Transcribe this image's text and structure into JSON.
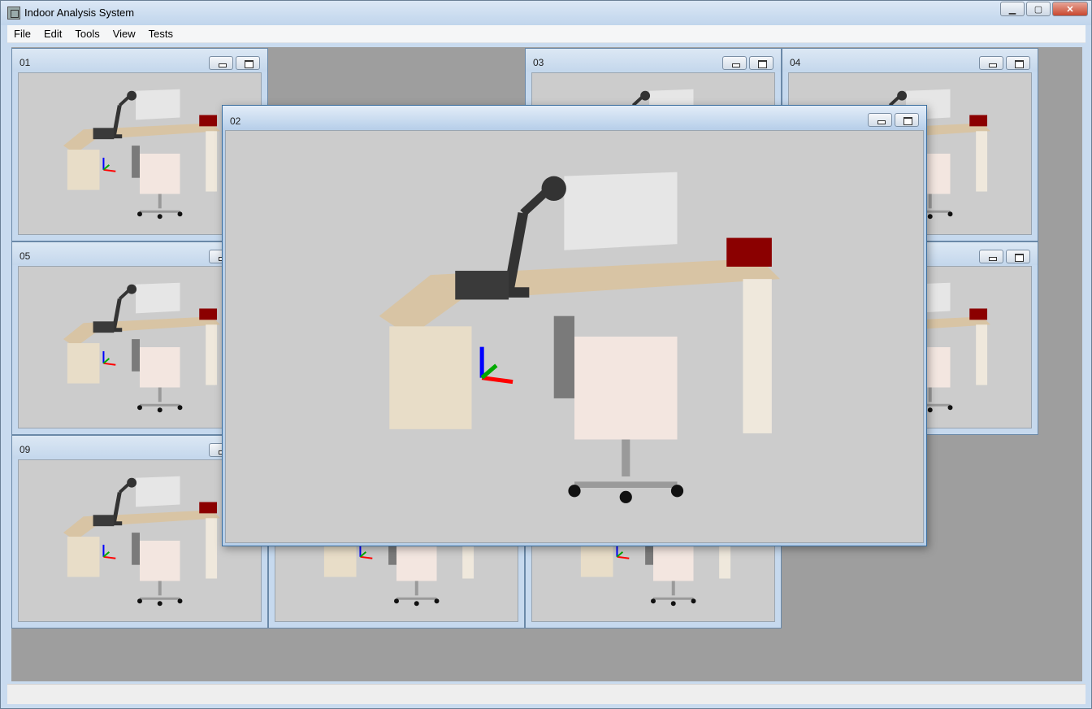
{
  "app": {
    "title": "Indoor Analysis System"
  },
  "window_controls": {
    "minimize": "▁",
    "maximize": "▢",
    "close": "✕"
  },
  "menu": [
    "File",
    "Edit",
    "Tools",
    "View",
    "Tests"
  ],
  "subwindows": {
    "w01": {
      "label": "01"
    },
    "w02": {
      "label": "02"
    },
    "w03": {
      "label": "03"
    },
    "w04": {
      "label": "04"
    },
    "w05": {
      "label": "05"
    },
    "w09": {
      "label": "09"
    }
  },
  "scene": {
    "description_icon": "point-cloud-desk-scene",
    "colors": {
      "background": "#cccccc",
      "desk": "#d8c4a4",
      "chair": "#f3e6e0",
      "lamp": "#333333",
      "box": "#8b0000",
      "monitor": "#e6e6e6",
      "axis_x": "#ff0000",
      "axis_y": "#00aa00",
      "axis_z": "#0000ff"
    }
  }
}
